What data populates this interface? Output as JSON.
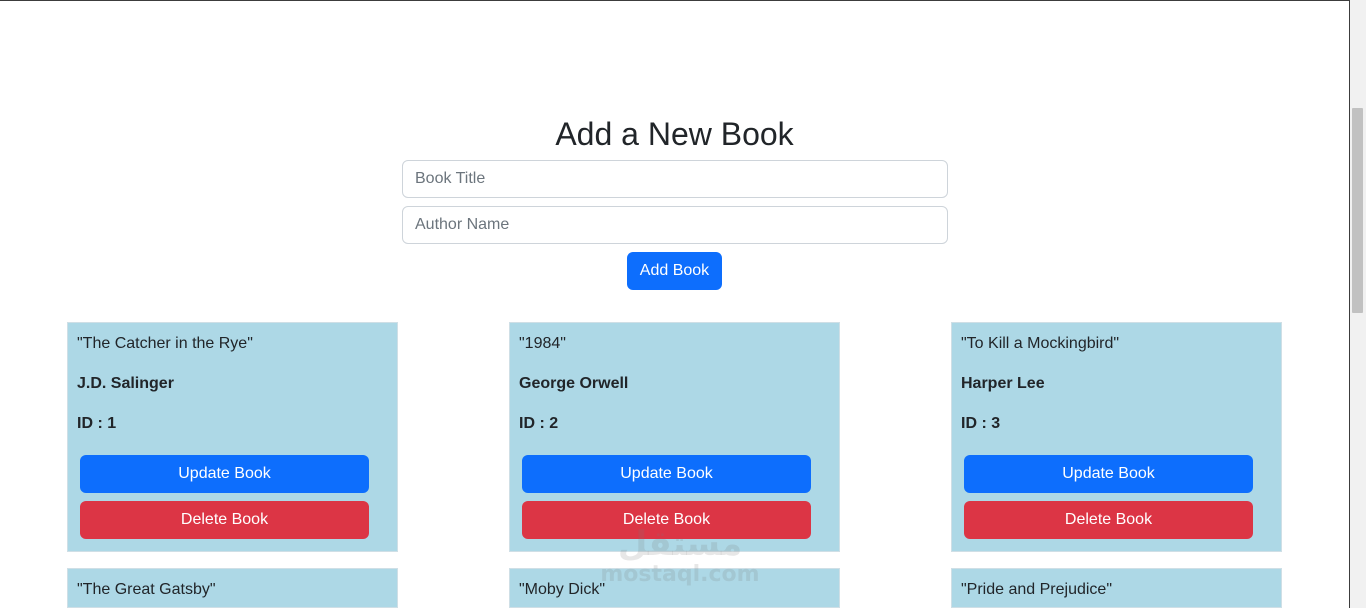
{
  "form": {
    "title": "Add a New Book",
    "title_placeholder": "Book Title",
    "author_placeholder": "Author Name",
    "add_label": "Add Book"
  },
  "books": [
    {
      "title": "\"The Catcher in the Rye\"",
      "author": "J.D. Salinger",
      "id": "ID : 1",
      "update_label": "Update Book",
      "delete_label": "Delete Book"
    },
    {
      "title": "\"1984\"",
      "author": "George Orwell",
      "id": "ID : 2",
      "update_label": "Update Book",
      "delete_label": "Delete Book"
    },
    {
      "title": "\"To Kill a Mockingbird\"",
      "author": "Harper Lee",
      "id": "ID : 3",
      "update_label": "Update Book",
      "delete_label": "Delete Book"
    },
    {
      "title": "\"The Great Gatsby\""
    },
    {
      "title": "\"Moby Dick\""
    },
    {
      "title": "\"Pride and Prejudice\""
    }
  ],
  "watermark": {
    "arabic": "مستقل",
    "latin": "mostaql.com"
  },
  "colors": {
    "primary": "#0d6efd",
    "danger": "#dc3545",
    "card": "#add8e6"
  }
}
